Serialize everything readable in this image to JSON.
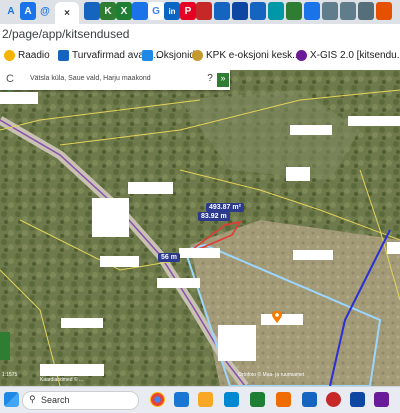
{
  "browser": {
    "url": "2/page/app/kitsendused",
    "tabs": [
      {
        "label": "A",
        "color": "#1a73e8"
      },
      {
        "label": "A",
        "color": "#1a73e8"
      },
      {
        "label": "@",
        "color": "#1a73e8"
      },
      {
        "label": "×",
        "color": "#333333"
      },
      {
        "label": "",
        "color": "#1565c0"
      },
      {
        "label": "K",
        "color": "#2e7d32"
      },
      {
        "label": "X",
        "color": "#1e7e34"
      },
      {
        "label": "",
        "color": "#1a73e8"
      },
      {
        "label": "G",
        "color": "#4285f4"
      },
      {
        "label": "in",
        "color": "#0a66c2"
      },
      {
        "label": "P",
        "color": "#e60023"
      }
    ]
  },
  "bookmarks": [
    {
      "label": "Raadio",
      "icon": "radio-icon"
    },
    {
      "label": "Turvafirmad avalik...",
      "icon": "shield-icon"
    },
    {
      "label": "Oksjonid",
      "icon": "auction-icon"
    },
    {
      "label": "KPK e-oksjoni kesk...",
      "icon": "kpk-icon"
    },
    {
      "label": "X-GIS 2.0 [kitsendu...",
      "icon": "xgis-icon"
    }
  ],
  "map": {
    "search_value": "Vätsla küla, Saue vald, Harju maakond",
    "search_help": "?",
    "search_expand": "»",
    "measure_area": "493.87 m²",
    "measure_length_1": "83.92 m",
    "measure_length_2": "56 m",
    "scale_text": "1:1575",
    "scale_credit": "Kaardiandmed © ...",
    "attribution": "Ortofoto © Maa- ja ruumiamet"
  },
  "taskbar": {
    "search_placeholder": "Search"
  }
}
